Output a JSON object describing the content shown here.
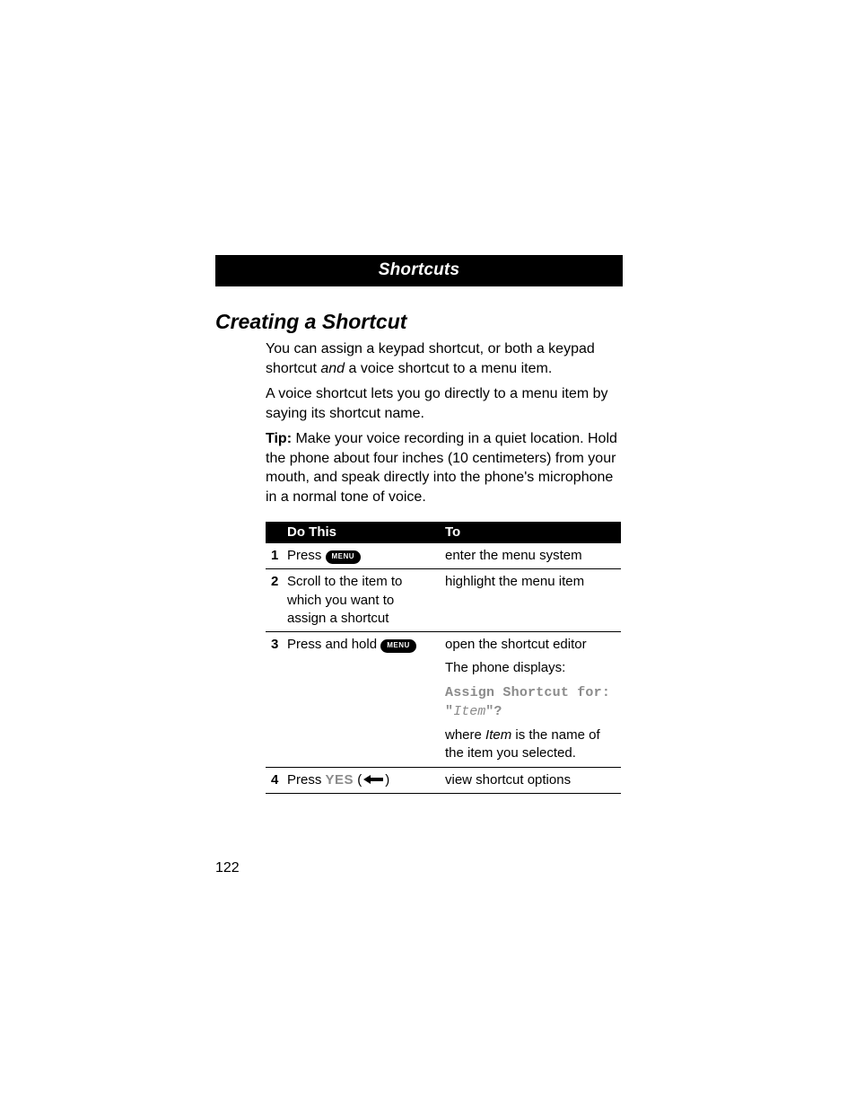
{
  "header": {
    "title": "Shortcuts"
  },
  "section": {
    "title": "Creating a Shortcut"
  },
  "paragraphs": {
    "p1_a": "You can assign a keypad shortcut, or both a keypad shortcut ",
    "p1_and": "and",
    "p1_b": " a voice shortcut to a menu item.",
    "p2": "A voice shortcut lets you go directly to a menu item by saying its shortcut name.",
    "p3_tip": "Tip:",
    "p3_rest": " Make your voice recording in a quiet location. Hold the phone about four inches (10 centimeters) from your mouth, and speak directly into the phone's microphone in a normal tone of voice."
  },
  "table": {
    "headers": {
      "dothis": "Do This",
      "to": "To"
    },
    "rows": [
      {
        "num": "1",
        "do_pre": "Press ",
        "key": "MENU",
        "to": "enter the menu system"
      },
      {
        "num": "2",
        "do": "Scroll to the item to which you want to assign a shortcut",
        "to": "highlight the menu item"
      },
      {
        "num": "3",
        "do_pre": "Press and hold ",
        "key": "MENU",
        "to_line1": "open the shortcut editor",
        "to_line2": "The phone displays:",
        "to_mono1": "Assign Shortcut for:",
        "to_mono2_a": "\"",
        "to_mono2_item": "Item",
        "to_mono2_b": "\"?",
        "to_line3_a": "where ",
        "to_line3_item": "Item",
        "to_line3_b": " is the name of the item you selected."
      },
      {
        "num": "4",
        "do_pre": "Press ",
        "yes": "YES",
        "paren_open": " (",
        "paren_close": ")",
        "to": "view shortcut options"
      }
    ]
  },
  "page_number": "122"
}
